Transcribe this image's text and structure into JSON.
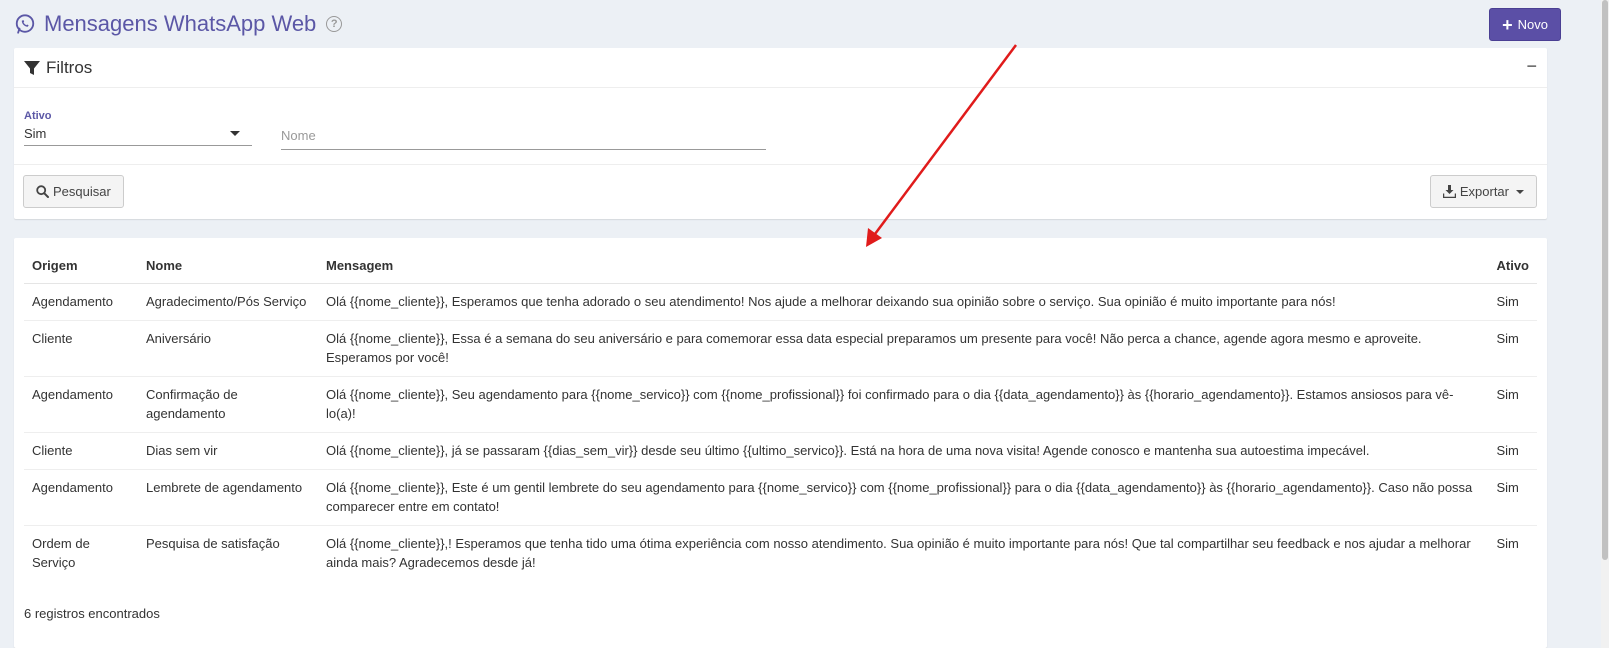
{
  "header": {
    "title": "Mensagens WhatsApp Web",
    "new_button": "Novo"
  },
  "filters": {
    "title": "Filtros",
    "collapse_label": "−",
    "ativo": {
      "label": "Ativo",
      "value": "Sim"
    },
    "nome": {
      "placeholder": "Nome",
      "value": ""
    },
    "search_button": "Pesquisar",
    "export_button": "Exportar"
  },
  "table": {
    "columns": [
      "Origem",
      "Nome",
      "Mensagem",
      "Ativo"
    ],
    "rows": [
      [
        "Agendamento",
        "Agradecimento/Pós Serviço",
        "Olá {{nome_cliente}}, Esperamos que tenha adorado o seu atendimento! Nos ajude a melhorar deixando sua opinião sobre o serviço. Sua opinião é muito importante para nós!",
        "Sim"
      ],
      [
        "Cliente",
        "Aniversário",
        "Olá {{nome_cliente}}, Essa é a semana do seu aniversário e para comemorar essa data especial preparamos um presente para você! Não perca a chance, agende agora mesmo e aproveite. Esperamos por você!",
        "Sim"
      ],
      [
        "Agendamento",
        "Confirmação de agendamento",
        "Olá {{nome_cliente}}, Seu agendamento para {{nome_servico}} com {{nome_profissional}} foi confirmado para o dia {{data_agendamento}} às {{horario_agendamento}}. Estamos ansiosos para vê-lo(a)!",
        "Sim"
      ],
      [
        "Cliente",
        "Dias sem vir",
        "Olá {{nome_cliente}}, já se passaram {{dias_sem_vir}} desde seu último {{ultimo_servico}}. Está na hora de uma nova visita! Agende conosco e mantenha sua autoestima impecável.",
        "Sim"
      ],
      [
        "Agendamento",
        "Lembrete de agendamento",
        "Olá {{nome_cliente}}, Este é um gentil lembrete do seu agendamento para {{nome_servico}} com {{nome_profissional}} para o dia {{data_agendamento}} às {{horario_agendamento}}. Caso não possa comparecer entre em contato!",
        "Sim"
      ],
      [
        "Ordem de Serviço",
        "Pesquisa de satisfação",
        "Olá {{nome_cliente}},! Esperamos que tenha tido uma ótima experiência com nosso atendimento. Sua opinião é muito importante para nós! Que tal compartilhar seu feedback e nos ajudar a melhorar ainda mais? Agradecemos desde já!",
        "Sim"
      ]
    ],
    "records_text": "6 registros encontrados"
  },
  "colors": {
    "accent": "#5b57a6",
    "primary_button": "#5b4fa6",
    "annotation_arrow": "#e01b1b"
  }
}
